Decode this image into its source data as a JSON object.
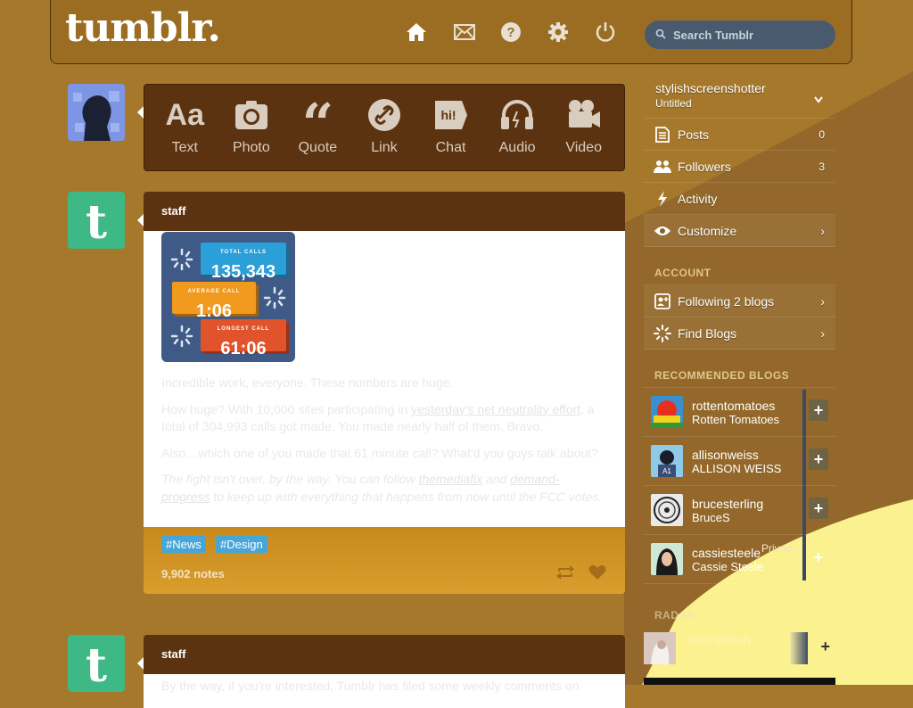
{
  "header": {
    "logo": "tumblr.",
    "search_placeholder": "Search Tumblr",
    "nav_icons": [
      "home-icon",
      "mail-icon",
      "help-icon",
      "gear-icon",
      "power-icon"
    ]
  },
  "post_types": [
    {
      "label": "Text",
      "icon": "text-icon"
    },
    {
      "label": "Photo",
      "icon": "camera-icon"
    },
    {
      "label": "Quote",
      "icon": "quote-icon"
    },
    {
      "label": "Link",
      "icon": "link-icon"
    },
    {
      "label": "Chat",
      "icon": "chat-icon"
    },
    {
      "label": "Audio",
      "icon": "headphones-icon"
    },
    {
      "label": "Video",
      "icon": "video-camera-icon"
    }
  ],
  "post1": {
    "author": "staff",
    "infographic": {
      "total_label": "TOTAL CALLS",
      "total_value": "135,343",
      "average_label": "AVERAGE CALL",
      "average_value": "1:06",
      "longest_label": "LONGEST CALL",
      "longest_value": "61:06"
    },
    "p1": "Incredible work, everyone. These numbers are huge.",
    "p2_a": "How huge? With 10,000 sites participating in ",
    "p2_link": "yesterday's net neutrality effort",
    "p2_b": ", a total of 304,993 calls got made. You made nearly half of them. Bravo.",
    "p3": "Also…which one of you made that 61 minute call? What'd you guys talk about?",
    "p4_a": "The fight isn't over, by the way. You can follow ",
    "p4_link1": "themediafix",
    "p4_mid": " and ",
    "p4_link2": "demand-progress",
    "p4_b": " to keep up with everything that happens from now until the FCC votes.",
    "tags": [
      "#News",
      "#Design"
    ],
    "notes": "9,902 notes"
  },
  "post2": {
    "author": "staff",
    "preview": "By the way, if you're interested, Tumblr has filed some weekly comments on"
  },
  "sidebar": {
    "blog_name": "stylishscreenshotter",
    "blog_title": "Untitled",
    "items": [
      {
        "label": "Posts",
        "count": "0",
        "icon": "posts-icon"
      },
      {
        "label": "Followers",
        "count": "3",
        "icon": "followers-icon"
      },
      {
        "label": "Activity",
        "count": "",
        "icon": "lightning-icon"
      },
      {
        "label": "Customize",
        "count": "",
        "icon": "eye-icon"
      }
    ],
    "account_label": "ACCOUNT",
    "account_items": [
      {
        "label": "Following 2 blogs",
        "icon": "following-icon"
      },
      {
        "label": "Find Blogs",
        "icon": "find-icon"
      }
    ],
    "recommended_label": "RECOMMENDED BLOGS",
    "recommended": [
      {
        "name": "rottentomatoes",
        "title": "Rotten Tomatoes"
      },
      {
        "name": "allisonweiss",
        "title": "ALLISON WEISS"
      },
      {
        "name": "brucesterling",
        "title": "BruceS"
      },
      {
        "name": "cassiesteele",
        "title": "Cassie Steele"
      }
    ],
    "footer_fragment": "Privacy",
    "radar_label": "RADAR",
    "radar_name": "stitchywitch"
  },
  "colors": {
    "background": "#a6782c",
    "header": "#9a6d22",
    "panel": "#5c3311",
    "tag": "#47a6d8"
  }
}
